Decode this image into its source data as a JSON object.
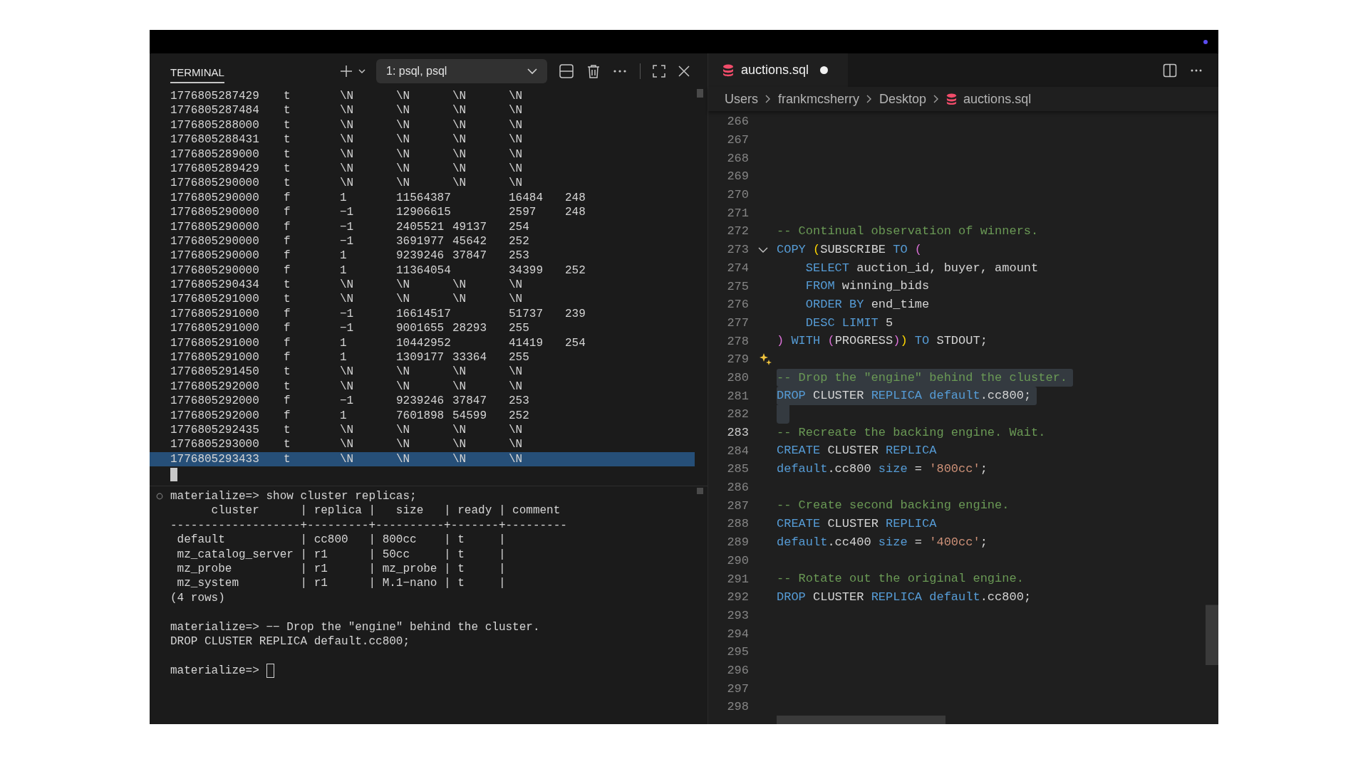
{
  "terminal": {
    "tab": {
      "label": "TERMINAL",
      "selected": true
    },
    "dropdown": "1: psql, psql",
    "rows": [
      {
        "cells": [
          "1776805287429",
          "t",
          "\\N",
          "\\N",
          "\\N",
          "\\N"
        ],
        "selected": false
      },
      {
        "cells": [
          "1776805287484",
          "t",
          "\\N",
          "\\N",
          "\\N",
          "\\N"
        ],
        "selected": false
      },
      {
        "cells": [
          "1776805288000",
          "t",
          "\\N",
          "\\N",
          "\\N",
          "\\N"
        ],
        "selected": false
      },
      {
        "cells": [
          "1776805288431",
          "t",
          "\\N",
          "\\N",
          "\\N",
          "\\N"
        ],
        "selected": false
      },
      {
        "cells": [
          "1776805289000",
          "t",
          "\\N",
          "\\N",
          "\\N",
          "\\N"
        ],
        "selected": false
      },
      {
        "cells": [
          "1776805289429",
          "t",
          "\\N",
          "\\N",
          "\\N",
          "\\N"
        ],
        "selected": false
      },
      {
        "cells": [
          "1776805290000",
          "t",
          "\\N",
          "\\N",
          "\\N",
          "\\N"
        ],
        "selected": false
      },
      {
        "cells": [
          "1776805290000",
          "f",
          "1",
          "11564387",
          null,
          "16484",
          "248"
        ],
        "selected": false
      },
      {
        "cells": [
          "1776805290000",
          "f",
          "−1",
          "12906615",
          null,
          "2597",
          "248"
        ],
        "selected": false
      },
      {
        "cells": [
          "1776805290000",
          "f",
          "−1",
          "2405521",
          "49137",
          "254"
        ],
        "selected": false
      },
      {
        "cells": [
          "1776805290000",
          "f",
          "−1",
          "3691977",
          "45642",
          "252"
        ],
        "selected": false
      },
      {
        "cells": [
          "1776805290000",
          "f",
          "1",
          "9239246",
          "37847",
          "253"
        ],
        "selected": false
      },
      {
        "cells": [
          "1776805290000",
          "f",
          "1",
          "11364054",
          null,
          "34399",
          "252"
        ],
        "selected": false
      },
      {
        "cells": [
          "1776805290434",
          "t",
          "\\N",
          "\\N",
          "\\N",
          "\\N"
        ],
        "selected": false
      },
      {
        "cells": [
          "1776805291000",
          "t",
          "\\N",
          "\\N",
          "\\N",
          "\\N"
        ],
        "selected": false
      },
      {
        "cells": [
          "1776805291000",
          "f",
          "−1",
          "16614517",
          null,
          "51737",
          "239"
        ],
        "selected": false
      },
      {
        "cells": [
          "1776805291000",
          "f",
          "−1",
          "9001655",
          "28293",
          "255"
        ],
        "selected": false
      },
      {
        "cells": [
          "1776805291000",
          "f",
          "1",
          "10442952",
          null,
          "41419",
          "254"
        ],
        "selected": false
      },
      {
        "cells": [
          "1776805291000",
          "f",
          "1",
          "1309177",
          "33364",
          "255"
        ],
        "selected": false
      },
      {
        "cells": [
          "1776805291450",
          "t",
          "\\N",
          "\\N",
          "\\N",
          "\\N"
        ],
        "selected": false
      },
      {
        "cells": [
          "1776805292000",
          "t",
          "\\N",
          "\\N",
          "\\N",
          "\\N"
        ],
        "selected": false
      },
      {
        "cells": [
          "1776805292000",
          "f",
          "−1",
          "9239246",
          "37847",
          "253"
        ],
        "selected": false
      },
      {
        "cells": [
          "1776805292000",
          "f",
          "1",
          "7601898",
          "54599",
          "252"
        ],
        "selected": false
      },
      {
        "cells": [
          "1776805292435",
          "t",
          "\\N",
          "\\N",
          "\\N",
          "\\N"
        ],
        "selected": false
      },
      {
        "cells": [
          "1776805293000",
          "t",
          "\\N",
          "\\N",
          "\\N",
          "\\N"
        ],
        "selected": false
      },
      {
        "cells": [
          "1776805293433",
          "t",
          "\\N",
          "\\N",
          "\\N",
          "\\N"
        ],
        "selected": true
      }
    ],
    "session_blocks": [
      {
        "lines": [
          "materialize=> show cluster replicas;",
          "      cluster      | replica |   size   | ready | comment",
          "-------------------+---------+----------+-------+---------",
          " default           | cc800   | 800cc    | t     |",
          " mz_catalog_server | r1      | 50cc     | t     |",
          " mz_probe          | r1      | mz_probe | t     |",
          " mz_system         | r1      | M.1−nano | t     |",
          "(4 rows)"
        ]
      },
      {
        "lines": [
          "materialize=> −− Drop the \"engine\" behind the cluster.",
          "DROP CLUSTER REPLICA default.cc800;"
        ]
      }
    ],
    "prompt": "materialize=>"
  },
  "editor": {
    "tab": {
      "label": "auctions.sql",
      "modified": true
    },
    "breadcrumb": [
      {
        "label": "Users",
        "kind": "folder"
      },
      {
        "label": "frankmcsherry",
        "kind": "folder"
      },
      {
        "label": "Desktop",
        "kind": "folder"
      },
      {
        "label": "auctions.sql",
        "kind": "file"
      }
    ],
    "lines": [
      {
        "n": "266",
        "selected": false,
        "current": false
      },
      {
        "n": "267",
        "selected": false,
        "current": false
      },
      {
        "n": "268",
        "selected": false,
        "current": false
      },
      {
        "n": "269",
        "selected": false,
        "current": false
      },
      {
        "n": "270",
        "selected": false,
        "current": false
      },
      {
        "n": "271",
        "selected": false,
        "current": false
      },
      {
        "n": "272",
        "selected": false,
        "current": false,
        "tokens": [
          {
            "text": "-- Continual observation of winners.",
            "kind": "comment"
          }
        ]
      },
      {
        "n": "273",
        "selected": false,
        "current": false,
        "kind": "fold",
        "tokens": [
          {
            "text": "COPY ",
            "kind": "keyword"
          },
          {
            "text": "(",
            "kind": "bracket1"
          },
          {
            "text": "SUBSCRIBE ",
            "kind": "plain"
          },
          {
            "text": "TO ",
            "kind": "keyword"
          },
          {
            "text": "(",
            "kind": "bracket2"
          }
        ]
      },
      {
        "n": "274",
        "selected": false,
        "current": false,
        "tokens": [
          {
            "text": "    SELECT ",
            "kind": "keyword"
          },
          {
            "text": "auction_id, buyer, amount",
            "kind": "plain"
          }
        ]
      },
      {
        "n": "275",
        "selected": false,
        "current": false,
        "tokens": [
          {
            "text": "    FROM ",
            "kind": "keyword"
          },
          {
            "text": "winning_bids",
            "kind": "plain"
          }
        ]
      },
      {
        "n": "276",
        "selected": false,
        "current": false,
        "tokens": [
          {
            "text": "    ORDER BY ",
            "kind": "keyword"
          },
          {
            "text": "end_time",
            "kind": "plain"
          }
        ]
      },
      {
        "n": "277",
        "selected": false,
        "current": false,
        "tokens": [
          {
            "text": "    DESC LIMIT ",
            "kind": "keyword"
          },
          {
            "text": "5",
            "kind": "plain"
          }
        ]
      },
      {
        "n": "278",
        "selected": false,
        "current": false,
        "tokens": [
          {
            "text": ")",
            "kind": "bracket2"
          },
          {
            "text": " WITH ",
            "kind": "keyword"
          },
          {
            "text": "(",
            "kind": "bracket2"
          },
          {
            "text": "PROGRESS",
            "kind": "plain"
          },
          {
            "text": ")",
            "kind": "bracket2"
          },
          {
            "text": ")",
            "kind": "bracket1"
          },
          {
            "text": " TO ",
            "kind": "keyword"
          },
          {
            "text": "STDOUT;",
            "kind": "plain"
          }
        ]
      },
      {
        "n": "279",
        "selected": false,
        "current": false,
        "kind": "sparkle"
      },
      {
        "n": "280",
        "selected": true,
        "current": false,
        "tokens": [
          {
            "text": "-- Drop the \"engine\" behind the cluster.",
            "kind": "comment"
          }
        ]
      },
      {
        "n": "281",
        "selected": true,
        "current": false,
        "tokens": [
          {
            "text": "DROP ",
            "kind": "keyword"
          },
          {
            "text": "CLUSTER ",
            "kind": "plain"
          },
          {
            "text": "REPLICA default",
            "kind": "keyword"
          },
          {
            "text": ".cc800;",
            "kind": "plain"
          }
        ]
      },
      {
        "n": "282",
        "selected": true,
        "current": false
      },
      {
        "n": "283",
        "selected": false,
        "current": true,
        "tokens": [
          {
            "text": "-- Recreate the backing engine. Wait.",
            "kind": "comment"
          }
        ]
      },
      {
        "n": "284",
        "selected": false,
        "current": false,
        "tokens": [
          {
            "text": "CREATE ",
            "kind": "keyword"
          },
          {
            "text": "CLUSTER ",
            "kind": "plain"
          },
          {
            "text": "REPLICA",
            "kind": "keyword"
          }
        ]
      },
      {
        "n": "285",
        "selected": false,
        "current": false,
        "tokens": [
          {
            "text": "default",
            "kind": "keyword"
          },
          {
            "text": ".cc800 ",
            "kind": "plain"
          },
          {
            "text": "size",
            "kind": "keyword"
          },
          {
            "text": " = ",
            "kind": "plain"
          },
          {
            "text": "'800cc'",
            "kind": "string"
          },
          {
            "text": ";",
            "kind": "plain"
          }
        ]
      },
      {
        "n": "286",
        "selected": false,
        "current": false
      },
      {
        "n": "287",
        "selected": false,
        "current": false,
        "tokens": [
          {
            "text": "-- Create second backing engine.",
            "kind": "comment"
          }
        ]
      },
      {
        "n": "288",
        "selected": false,
        "current": false,
        "tokens": [
          {
            "text": "CREATE ",
            "kind": "keyword"
          },
          {
            "text": "CLUSTER ",
            "kind": "plain"
          },
          {
            "text": "REPLICA",
            "kind": "keyword"
          }
        ]
      },
      {
        "n": "289",
        "selected": false,
        "current": false,
        "tokens": [
          {
            "text": "default",
            "kind": "keyword"
          },
          {
            "text": ".cc400 ",
            "kind": "plain"
          },
          {
            "text": "size",
            "kind": "keyword"
          },
          {
            "text": " = ",
            "kind": "plain"
          },
          {
            "text": "'400cc'",
            "kind": "string"
          },
          {
            "text": ";",
            "kind": "plain"
          }
        ]
      },
      {
        "n": "290",
        "selected": false,
        "current": false
      },
      {
        "n": "291",
        "selected": false,
        "current": false,
        "tokens": [
          {
            "text": "-- Rotate out the original engine.",
            "kind": "comment"
          }
        ]
      },
      {
        "n": "292",
        "selected": false,
        "current": false,
        "tokens": [
          {
            "text": "DROP ",
            "kind": "keyword"
          },
          {
            "text": "CLUSTER ",
            "kind": "plain"
          },
          {
            "text": "REPLICA default",
            "kind": "keyword"
          },
          {
            "text": ".cc800;",
            "kind": "plain"
          }
        ]
      },
      {
        "n": "293",
        "selected": false,
        "current": false
      },
      {
        "n": "294",
        "selected": false,
        "current": false
      },
      {
        "n": "295",
        "selected": false,
        "current": false
      },
      {
        "n": "296",
        "selected": false,
        "current": false
      },
      {
        "n": "297",
        "selected": false,
        "current": false
      },
      {
        "n": "298",
        "selected": false,
        "current": false
      }
    ]
  }
}
